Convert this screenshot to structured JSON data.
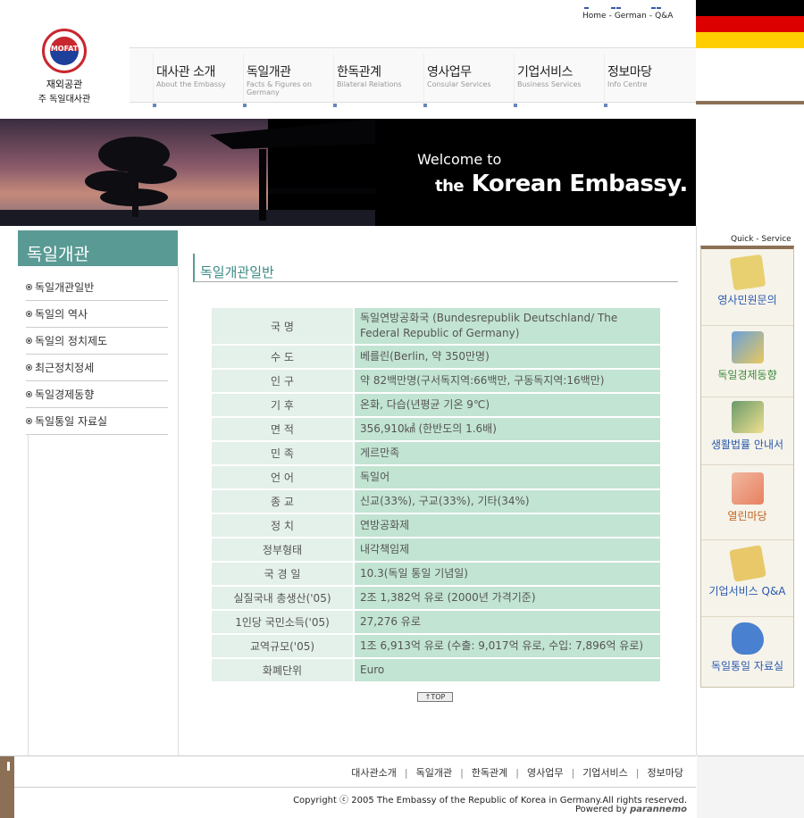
{
  "top_links": [
    "Home",
    "German",
    "Q&A"
  ],
  "logo": {
    "emblem_text": "MOFAT",
    "line1": "재외공관",
    "line2": "주 독일대사관"
  },
  "nav": [
    {
      "ko": "대사관 소개",
      "en": "About the Embassy"
    },
    {
      "ko": "독일개관",
      "en": "Facts & Figures on Germany"
    },
    {
      "ko": "한독관계",
      "en": "Bilateral Relations"
    },
    {
      "ko": "영사업무",
      "en": "Consular Services"
    },
    {
      "ko": "기업서비스",
      "en": "Business Services"
    },
    {
      "ko": "정보마당",
      "en": "Info Centre"
    }
  ],
  "banner": {
    "line1": "Welcome to",
    "line2_prefix": "the",
    "line2": "Korean Embassy."
  },
  "sidebar": {
    "title": "독일개관",
    "items": [
      "독일개관일반",
      "독일의 역사",
      "독일의 정치제도",
      "최근정치정세",
      "독일경제동향",
      "독일통일 자료실"
    ]
  },
  "content": {
    "title": "독일개관일반",
    "rows": [
      {
        "key": "국 명",
        "value": "독일연방공화국 (Bundesrepublik Deutschland/ The Federal Republic of Germany)"
      },
      {
        "key": "수 도",
        "value": "베를린(Berlin, 약 350만명)"
      },
      {
        "key": "인 구",
        "value": "약 82백만명(구서독지역:66백만, 구동독지역:16백만)"
      },
      {
        "key": "기 후",
        "value": "온화, 다습(년평균 기온 9℃)"
      },
      {
        "key": "면 적",
        "value": "356,910㎢ (한반도의 1.6배)"
      },
      {
        "key": "민 족",
        "value": "게르만족"
      },
      {
        "key": "언 어",
        "value": "독일어"
      },
      {
        "key": "종 교",
        "value": "신교(33%), 구교(33%), 기타(34%)"
      },
      {
        "key": "정 치",
        "value": "연방공화제"
      },
      {
        "key": "정부형태",
        "value": "내각책임제"
      },
      {
        "key": "국 경 일",
        "value": "10.3(독일 통일 기념일)"
      },
      {
        "key": "실질국내 총생산('05)",
        "value": "2조 1,382억 유로 (2000년 가격기준)"
      },
      {
        "key": "1인당 국민소득('05)",
        "value": "27,276 유로"
      },
      {
        "key": "교역규모('05)",
        "value": "1조 6,913억 유로 (수출: 9,017억 유로, 수입: 7,896억 유로)"
      },
      {
        "key": "화폐단위",
        "value": "Euro"
      }
    ],
    "top_button": "TOP"
  },
  "quick_service": {
    "title": "Quick - Service",
    "items": [
      {
        "label": "영사민원문의",
        "icon": "note-icon",
        "color": "#2a5ab0"
      },
      {
        "label": "독일경제동향",
        "icon": "chart-book-icon",
        "color": "#3a8a3a"
      },
      {
        "label": "생활법률 안내서",
        "icon": "book-bulb-icon",
        "color": "#2a5ab0"
      },
      {
        "label": "열린마당",
        "icon": "people-icon",
        "color": "#c0601a"
      },
      {
        "label": "기업서비스 Q&A",
        "icon": "qa-icon",
        "color": "#2a5ab0"
      },
      {
        "label": "독일통일 자료실",
        "icon": "germany-map-icon",
        "color": "#2a5ab0"
      }
    ]
  },
  "footer": {
    "links": [
      "대사관소개",
      "독일개관",
      "한독관계",
      "영사업무",
      "기업서비스",
      "정보마당"
    ],
    "copyright": "Copyright ⓒ 2005 The Embassy of the Republic of Korea in Germany.All rights reserved.",
    "powered_prefix": "Powered by",
    "powered_brand": "parannemo"
  },
  "colors": {
    "accent": "#5a9a94",
    "table_key_bg": "#e4f0ea",
    "table_val_bg": "#c2e4d2",
    "brown": "#8b7056"
  }
}
